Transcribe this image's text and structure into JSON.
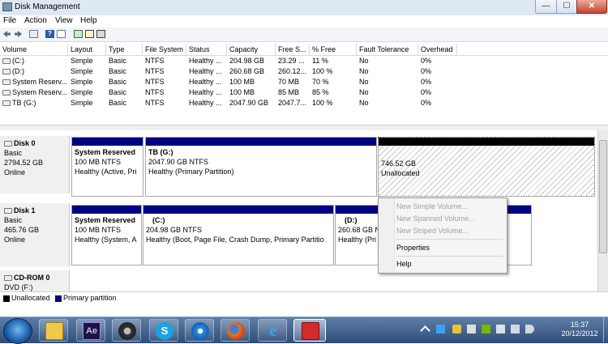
{
  "window": {
    "title": "Disk Management",
    "min_glyph": "—",
    "max_glyph": "☐",
    "close_glyph": "✕"
  },
  "menu": [
    "File",
    "Action",
    "View",
    "Help"
  ],
  "toolbar_icons": [
    "back-icon",
    "forward-icon",
    "console-tree-icon",
    "help-icon",
    "properties-icon",
    "refresh-icon",
    "rescan-icon",
    "settings-icon"
  ],
  "columns": [
    "Volume",
    "Layout",
    "Type",
    "File System",
    "Status",
    "Capacity",
    "Free S...",
    "% Free",
    "Fault Tolerance",
    "Overhead"
  ],
  "volumes": [
    [
      "(C:)",
      "Simple",
      "Basic",
      "NTFS",
      "Healthy ...",
      "204.98 GB",
      "23.29 ...",
      "11 %",
      "No",
      "0%"
    ],
    [
      "(D:)",
      "Simple",
      "Basic",
      "NTFS",
      "Healthy ...",
      "260.68 GB",
      "260.12...",
      "100 %",
      "No",
      "0%"
    ],
    [
      "System Reserv...",
      "Simple",
      "Basic",
      "NTFS",
      "Healthy ...",
      "100 MB",
      "70 MB",
      "70 %",
      "No",
      "0%"
    ],
    [
      "System Reserv...",
      "Simple",
      "Basic",
      "NTFS",
      "Healthy ...",
      "100 MB",
      "85 MB",
      "85 %",
      "No",
      "0%"
    ],
    [
      "TB (G:)",
      "Simple",
      "Basic",
      "NTFS",
      "Healthy ...",
      "2047.90 GB",
      "2047.7...",
      "100 %",
      "No",
      "0%"
    ]
  ],
  "disks": [
    {
      "name": "Disk 0",
      "type": "Basic",
      "size": "2794.52 GB",
      "status": "Online",
      "parts": [
        {
          "title": "System Reserved",
          "line2": "100 MB NTFS",
          "line3": "Healthy (Active, Pri"
        },
        {
          "title": "TB  (G:)",
          "line2": "2047.90 GB NTFS",
          "line3": "Healthy (Primary Partition)"
        },
        {
          "title": "",
          "line2": "746.52 GB",
          "line3": "Unallocated"
        }
      ]
    },
    {
      "name": "Disk 1",
      "type": "Basic",
      "size": "465.76 GB",
      "status": "Online",
      "parts": [
        {
          "title": "System Reserved",
          "line2": "100 MB NTFS",
          "line3": "Healthy (System, A"
        },
        {
          "title": "(C:)",
          "line2": "204.98 GB NTFS",
          "line3": "Healthy (Boot, Page File, Crash Dump, Primary Partitio"
        },
        {
          "title": "(D:)",
          "line2": "260.68 GB NTFS",
          "line3": "Healthy (Pri"
        }
      ]
    },
    {
      "name": "CD-ROM 0",
      "type": "DVD (F:)",
      "size": "",
      "status": "",
      "parts": []
    }
  ],
  "legend": [
    {
      "label": "Unallocated",
      "color": "#000000"
    },
    {
      "label": "Primary partition",
      "color": "#000080"
    }
  ],
  "context_menu": {
    "items": [
      {
        "label": "New Simple Volume...",
        "enabled": false
      },
      {
        "label": "New Spanned Volume...",
        "enabled": false
      },
      {
        "label": "New Striped Volume...",
        "enabled": false
      },
      {
        "label": "Properties",
        "enabled": true
      },
      {
        "label": "Help",
        "enabled": true
      }
    ]
  },
  "taskbar": {
    "apps": [
      "explorer-folder-icon",
      "after-effects-icon",
      "steam-icon",
      "skype-icon",
      "network-app-icon",
      "firefox-icon",
      "internet-explorer-icon",
      "toolbox-icon"
    ],
    "ae_text": "Ae",
    "time": "15:37",
    "date": "20/12/2012"
  },
  "colors": {
    "primary": "#000080",
    "unallocated": "#000000",
    "titlebar": "#dfe9f5"
  }
}
